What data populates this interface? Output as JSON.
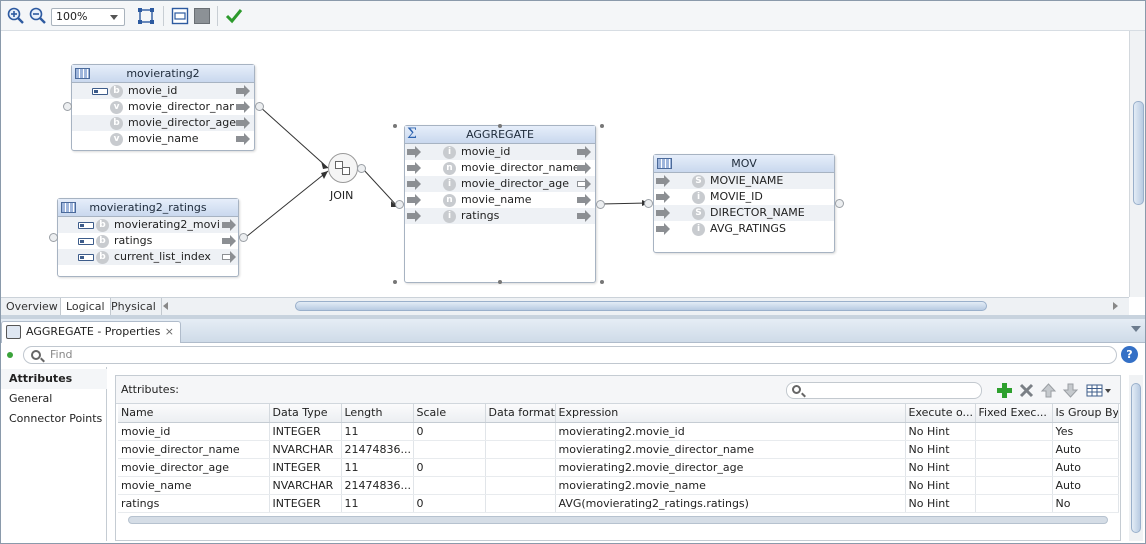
{
  "toolbar": {
    "zoom_value": "100%",
    "icons": [
      "zoom-in-icon",
      "zoom-out-icon",
      "fit-to-view-icon",
      "layout-icon",
      "grid-icon",
      "validate-check-icon"
    ]
  },
  "canvas": {
    "movierating2": {
      "title": "movierating2",
      "rows": [
        {
          "type": "b",
          "key": true,
          "label": "movie_id"
        },
        {
          "type": "v",
          "key": false,
          "label": "movie_director_nam"
        },
        {
          "type": "b",
          "key": false,
          "label": "movie_director_age"
        },
        {
          "type": "v",
          "key": false,
          "label": "movie_name"
        }
      ]
    },
    "ratings": {
      "title": "movierating2_ratings",
      "rows": [
        {
          "type": "b",
          "key": true,
          "label": "movierating2_movi"
        },
        {
          "type": "b",
          "key": false,
          "label": "ratings"
        },
        {
          "type": "b",
          "key": true,
          "label": "current_list_index"
        }
      ]
    },
    "join_label": "JOIN",
    "aggregate": {
      "title": "AGGREGATE",
      "rows": [
        {
          "type": "i",
          "label": "movie_id"
        },
        {
          "type": "n",
          "label": "movie_director_name"
        },
        {
          "type": "i",
          "label": "movie_director_age"
        },
        {
          "type": "n",
          "label": "movie_name"
        },
        {
          "type": "i",
          "label": "ratings"
        }
      ]
    },
    "mov": {
      "title": "MOV",
      "rows": [
        {
          "type": "S",
          "label": "MOVIE_NAME"
        },
        {
          "type": "i",
          "label": "MOVIE_ID"
        },
        {
          "type": "S",
          "label": "DIRECTOR_NAME"
        },
        {
          "type": "i",
          "label": "AVG_RATINGS"
        }
      ]
    },
    "tabs": [
      "Overview",
      "Logical",
      "Physical"
    ],
    "active_tab": "Logical"
  },
  "properties": {
    "tab_title": "AGGREGATE - Properties",
    "close_glyph": "×",
    "find_placeholder": "Find",
    "help_glyph": "?",
    "nav": [
      "Attributes",
      "General",
      "Connector Points"
    ],
    "attributes_label": "Attributes:",
    "columns": [
      "Name",
      "Data Type",
      "Length",
      "Scale",
      "Data format",
      "Expression",
      "Execute o...",
      "Fixed Exec...",
      "Is Group By"
    ],
    "rows": [
      [
        "movie_id",
        "INTEGER",
        "11",
        "0",
        "",
        "movierating2.movie_id",
        "No Hint",
        "",
        "Yes"
      ],
      [
        "movie_director_name",
        "NVARCHAR",
        "21474836...",
        "",
        "",
        "movierating2.movie_director_name",
        "No Hint",
        "",
        "Auto"
      ],
      [
        "movie_director_age",
        "INTEGER",
        "11",
        "0",
        "",
        "movierating2.movie_director_age",
        "No Hint",
        "",
        "Auto"
      ],
      [
        "movie_name",
        "NVARCHAR",
        "21474836...",
        "",
        "",
        "movierating2.movie_name",
        "No Hint",
        "",
        "Auto"
      ],
      [
        "ratings",
        "INTEGER",
        "11",
        "0",
        "",
        "AVG(movierating2_ratings.ratings)",
        "No Hint",
        "",
        "No"
      ]
    ]
  },
  "colors": {
    "accent": "#3470c6",
    "header_gradient": "#c9d8ee",
    "add_green": "#2ea02e",
    "check_green": "#2c9a2c"
  }
}
